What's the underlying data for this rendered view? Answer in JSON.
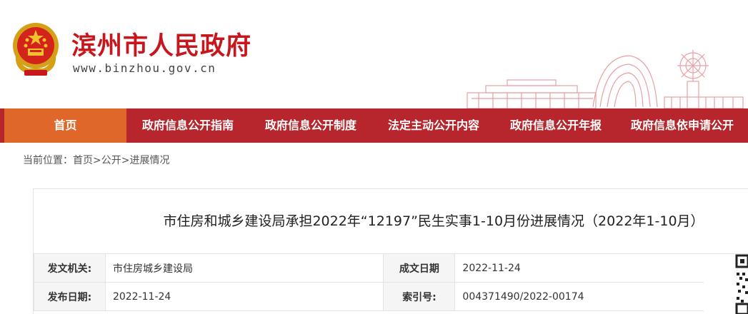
{
  "header": {
    "site_title": "滨州市人民政府",
    "site_url": "www.binzhou.gov.cn",
    "emblem_icon": "national-emblem-icon",
    "brand_color": "#c8161d"
  },
  "nav": {
    "items": [
      {
        "label": "首页",
        "active": true
      },
      {
        "label": "政府信息公开指南"
      },
      {
        "label": "政府信息公开制度"
      },
      {
        "label": "法定主动公开内容"
      },
      {
        "label": "政府信息公开年报"
      },
      {
        "label": "政府信息依申请公开"
      }
    ],
    "bar_color": "#b8262d",
    "active_color": "#e0672a"
  },
  "breadcrumb": {
    "prefix": "当前位置：",
    "home": "首页",
    "sep1": ">",
    "section": "公开",
    "sep2": ">",
    "current": "进展情况"
  },
  "document": {
    "title": "市住房和城乡建设局承担2022年“12197”民生实事1-10月份进展情况（2022年1-10月）",
    "meta": {
      "issuer_label": "发文机关:",
      "issuer_value": "市住房城乡建设局",
      "created_label": "成文日期",
      "created_value": "2022-11-24",
      "published_label": "发布日期:",
      "published_value": "2022-11-24",
      "index_label": "索引号:",
      "index_value": "004371490/2022-00174"
    }
  }
}
